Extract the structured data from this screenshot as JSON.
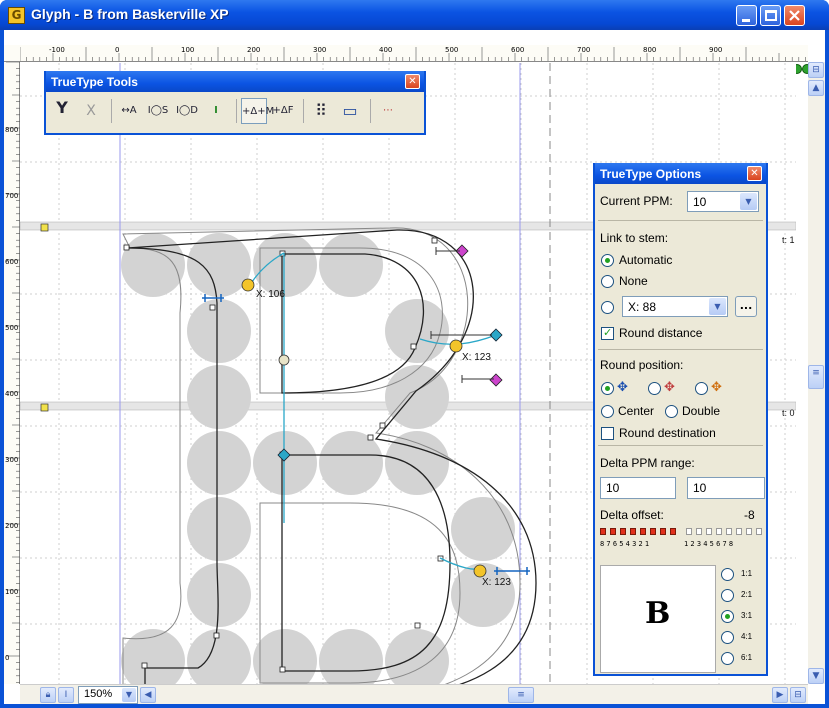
{
  "window": {
    "title": "Glyph - B from Baskerville XP",
    "app_icon": "G"
  },
  "ruler_top": [
    "-100",
    "0",
    "100",
    "200",
    "300",
    "400",
    "500",
    "600",
    "700",
    "800",
    "900"
  ],
  "ruler_left": [
    "800",
    "700",
    "600",
    "500",
    "400",
    "300",
    "200",
    "100",
    "0"
  ],
  "canvas": {
    "labels": [
      "X: 106",
      "X: 123",
      "X: 123"
    ],
    "side_labels": [
      "t: 1",
      "t: 0"
    ]
  },
  "tools_palette": {
    "title": "TrueType Tools",
    "buttons": [
      "Y",
      "X",
      "↔A",
      "I◯S",
      "I◯D",
      "I",
      "+Δ+M",
      "+ΔF",
      "⠿",
      "▭",
      "⋯"
    ]
  },
  "options_palette": {
    "title": "TrueType Options",
    "current_ppm_label": "Current PPM:",
    "current_ppm_value": "10",
    "link_to_stem_label": "Link to stem:",
    "link_options": [
      "Automatic",
      "None"
    ],
    "link_selected": "Automatic",
    "stem_value": "X: 88",
    "more_button": "...",
    "round_distance_label": "Round distance",
    "round_distance_checked": true,
    "round_position_label": "Round position:",
    "center_label": "Center",
    "double_label": "Double",
    "round_destination_label": "Round destination",
    "round_destination_checked": false,
    "delta_ppm_label": "Delta PPM range:",
    "delta_ppm_from": "10",
    "delta_ppm_to": "10",
    "delta_offset_label": "Delta offset:",
    "delta_offset_value": "-8",
    "delta_neg_digits": "87654321",
    "delta_pos_digits": "12345678",
    "preview_glyph": "B",
    "scales": [
      "1:1",
      "2:1",
      "3:1",
      "4:1",
      "6:1"
    ],
    "scale_selected": "3:1"
  },
  "status": {
    "zoom": "150%",
    "zoom_icon": "chevron-down-icon"
  },
  "colors": {
    "titlebar": "#0b54e3",
    "point_cyan": "#2aa7c8",
    "point_magenta": "#cc44cc",
    "delta_red": "#e0301c",
    "pixel_gray": "#d3d3d3"
  }
}
